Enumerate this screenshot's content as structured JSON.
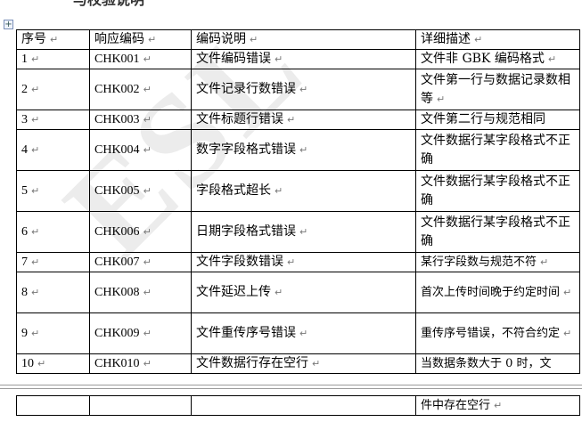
{
  "heading": "与校验说明",
  "table": {
    "headers": [
      "序号",
      "响应编码",
      "编码说明",
      "详细描述"
    ],
    "rows": [
      {
        "seq": "1",
        "code": "CHK001",
        "explain": "文件编码错误",
        "detail": "文件非 GBK 编码格式"
      },
      {
        "seq": "2",
        "code": "CHK002",
        "explain": "文件记录行数错误",
        "detail": "文件第一行与数据记录数相等"
      },
      {
        "seq": "3",
        "code": "CHK003",
        "explain": "文件标题行错误",
        "detail": "文件第二行与规范相同"
      },
      {
        "seq": "4",
        "code": "CHK004",
        "explain": "数字字段格式错误",
        "detail": "文件数据行某字段格式不正确"
      },
      {
        "seq": "5",
        "code": "CHK005",
        "explain": "字段格式超长",
        "detail": "文件数据行某字段格式不正确"
      },
      {
        "seq": "6",
        "code": "CHK006",
        "explain": "日期字段格式错误",
        "detail": "文件数据行某字段格式不正确"
      },
      {
        "seq": "7",
        "code": "CHK007",
        "explain": "文件字段数错误",
        "detail": "某行字段数与规范不符"
      },
      {
        "seq": "8",
        "code": "CHK008",
        "explain": "文件延迟上传",
        "detail": "首次上传时间晚于约定时间"
      },
      {
        "seq": "9",
        "code": "CHK009",
        "explain": "文件重传序号错误",
        "detail": "重传序号错误，不符合约定"
      },
      {
        "seq": "10",
        "code": "CHK010",
        "explain": "文件数据行存在空行",
        "detail": "当数据条数大于 0 时，文"
      }
    ],
    "continuation": "件中存在空行"
  },
  "colors": {
    "border": "#000000",
    "watermark": "#ececec",
    "page_break": "#9a9a9a"
  }
}
